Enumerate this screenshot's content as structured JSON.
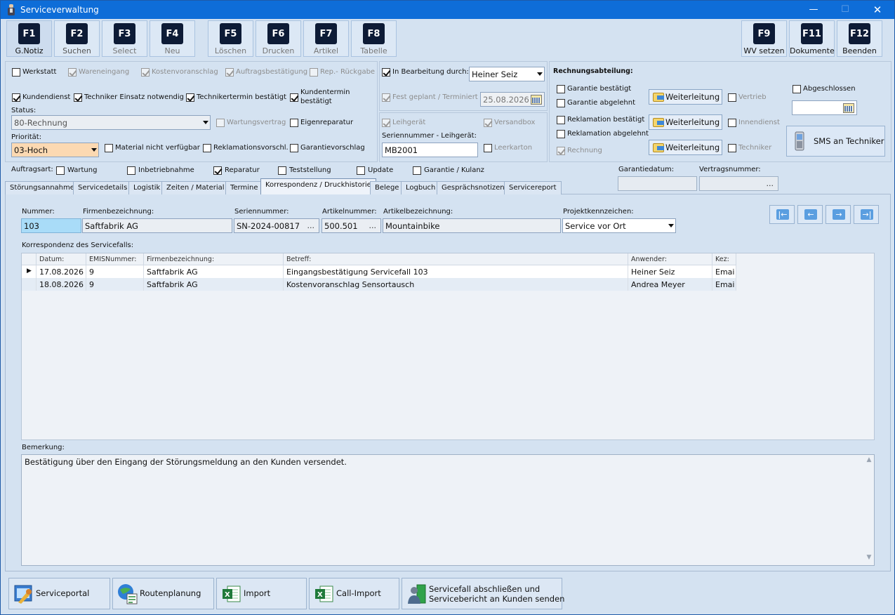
{
  "window": {
    "title": "Serviceverwaltung"
  },
  "fkeys": [
    {
      "key": "F1",
      "label": "G.Notiz"
    },
    {
      "key": "F2",
      "label": "Suchen"
    },
    {
      "key": "F3",
      "label": "Select"
    },
    {
      "key": "F4",
      "label": "Neu"
    },
    {
      "key": "F5",
      "label": "Löschen"
    },
    {
      "key": "F6",
      "label": "Drucken"
    },
    {
      "key": "F7",
      "label": "Artikel"
    },
    {
      "key": "F8",
      "label": "Tabelle"
    },
    {
      "key": "F9",
      "label": "WV setzen"
    },
    {
      "key": "F11",
      "label": "Dokumente"
    },
    {
      "key": "F12",
      "label": "Beenden"
    }
  ],
  "checks": {
    "werkstatt": "Werkstatt",
    "wareneingang": "Wareneingang",
    "kostenvoranschlag": "Kostenvoranschlag",
    "auftragsbestaetigung": "Auftragsbestätigung",
    "rep_rueckgabe": "Rep.- Rückgabe",
    "kundendienst": "Kundendienst",
    "techniker_einsatz": "Techniker Einsatz notwendig",
    "technikertermin": "Technikertermin bestätigt",
    "kundentermin_1": "Kundentermin",
    "kundentermin_2": "bestätigt",
    "wartungsvertrag": "Wartungsvertrag",
    "eigenreparatur": "Eigenreparatur",
    "material_nv": "Material nicht verfügbar",
    "reklamationsvorschl": "Reklamationsvorschl.",
    "garantievorschlag": "Garantievorschlag",
    "in_bearbeitung": "In Bearbeitung durch:",
    "fest_geplant": "Fest geplant / Terminiert",
    "leihgeraet": "Leihgerät",
    "versandbox": "Versandbox",
    "leerkarton": "Leerkarton"
  },
  "status": {
    "label": "Status:",
    "value": "80-Rechnung"
  },
  "prioritaet": {
    "label": "Priorität:",
    "value": "03-Hoch"
  },
  "bearbeiter": "Heiner Seiz",
  "termin_datum": "25.08.2026",
  "leihgeraet": {
    "label": "Seriennummer - Leihgerät:",
    "value": "MB2001"
  },
  "rechnung": {
    "title": "Rechnungsabteilung:",
    "garantie_best": "Garantie bestätigt",
    "garantie_abg": "Garantie abgelehnt",
    "reklamation_best": "Reklamation bestätigt",
    "reklamation_abg": "Reklamation abgelehnt",
    "rechnung": "Rechnung",
    "weiterleitung": "Weiterleitung",
    "vertrieb": "Vertrieb",
    "innendienst": "Innendienst",
    "techniker": "Techniker",
    "abgeschlossen": "Abgeschlossen",
    "sms": "SMS an Techniker"
  },
  "auftragsart": {
    "label": "Auftragsart:",
    "wartung": "Wartung",
    "inbetriebnahme": "Inbetriebnahme",
    "reparatur": "Reparatur",
    "teststellung": "Teststellung",
    "update": "Update",
    "garantie": "Garantie / Kulanz"
  },
  "garantiedatum_label": "Garantiedatum:",
  "vertragsnummer_label": "Vertragsnummer:",
  "vertragsnummer_ell": "...",
  "tabs": [
    "Störungsannahme",
    "Servicedetails",
    "Logistik",
    "Zeiten / Material",
    "Termine",
    "Korrespondenz / Druckhistorie",
    "Belege",
    "Logbuch",
    "Gesprächsnotizen",
    "Servicereport"
  ],
  "detail": {
    "nummer_label": "Nummer:",
    "nummer": "103",
    "firma_label": "Firmenbezeichnung:",
    "firma": "Saftfabrik AG",
    "serien_label": "Seriennummer:",
    "serien": "SN-2024-00817",
    "artnr_label": "Artikelnummer:",
    "artnr": "500.501",
    "artbez_label": "Artikelbezeichnung:",
    "artbez": "Mountainbike",
    "projekt_label": "Projektkennzeichen:",
    "projekt": "Service vor Ort",
    "ellipsis": "..."
  },
  "nav": {
    "first": "|←",
    "prev": "←",
    "next": "→",
    "last": "→|"
  },
  "grid": {
    "title": "Korrespondenz des Servicefalls:",
    "columns": [
      "Datum:",
      "EMISNummer:",
      "Firmenbezeichnung:",
      "Betreff:",
      "Anwender:",
      "Kez:"
    ],
    "rows": [
      [
        "17.08.2026",
        "9",
        "Saftfabrik AG",
        "Eingangsbestätigung Servicefall 103",
        "Heiner Seiz",
        "Emai"
      ],
      [
        "18.08.2026",
        "9",
        "Saftfabrik AG",
        "Kostenvoranschlag Sensortausch",
        "Andrea Meyer",
        "Emai"
      ]
    ]
  },
  "bemerkung": {
    "label": "Bemerkung:",
    "text": "Bestätigung über den Eingang der Störungsmeldung an den Kunden versendet."
  },
  "bottom": {
    "serviceportal": "Serviceportal",
    "routenplanung": "Routenplanung",
    "import": "Import",
    "call_import": "Call-Import",
    "abschliessen_1": "Servicefall abschließen und",
    "abschliessen_2": "Servicebericht an Kunden senden"
  }
}
